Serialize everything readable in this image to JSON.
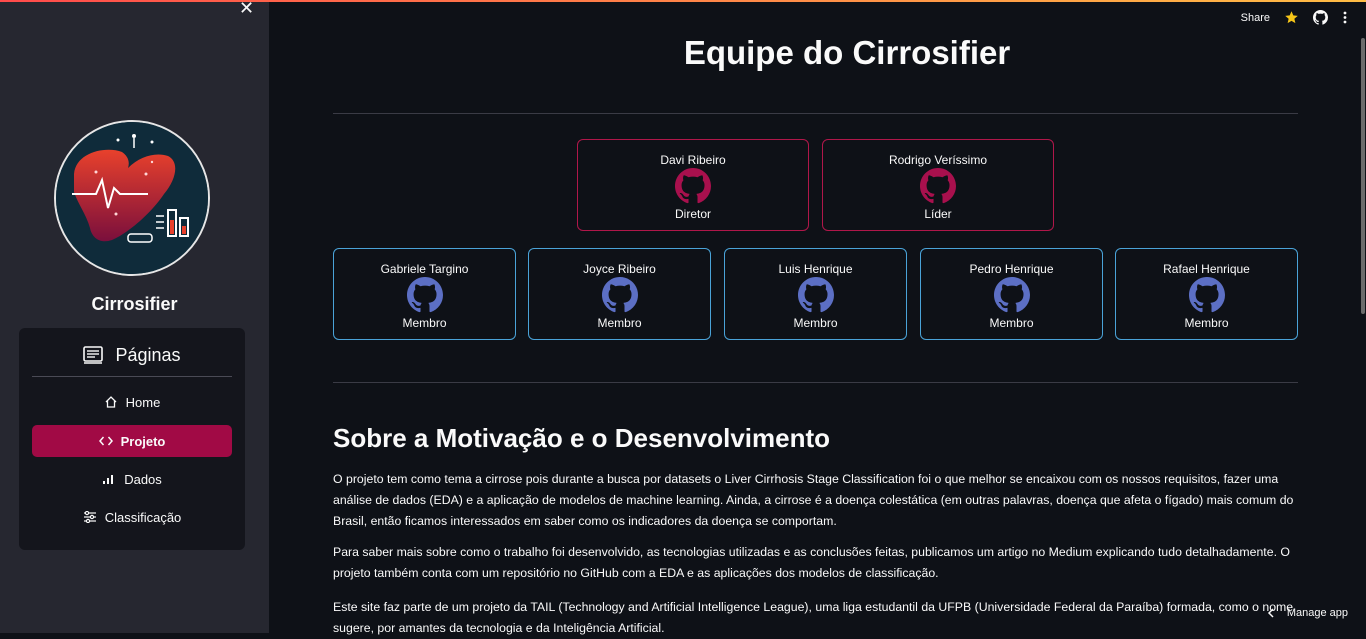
{
  "sidebar": {
    "app_title": "Cirrosifier",
    "nav_header": "Páginas",
    "items": [
      {
        "label": "Home"
      },
      {
        "label": "Projeto"
      },
      {
        "label": "Dados"
      },
      {
        "label": "Classificação"
      }
    ]
  },
  "toolbar": {
    "share_label": "Share"
  },
  "main": {
    "title": "Equipe do Cirrosifier",
    "leads": [
      {
        "name": "Davi Ribeiro",
        "role": "Diretor"
      },
      {
        "name": "Rodrigo Veríssimo",
        "role": "Líder"
      }
    ],
    "members": [
      {
        "name": "Gabriele Targino",
        "role": "Membro"
      },
      {
        "name": "Joyce Ribeiro",
        "role": "Membro"
      },
      {
        "name": "Luis Henrique",
        "role": "Membro"
      },
      {
        "name": "Pedro Henrique",
        "role": "Membro"
      },
      {
        "name": "Rafael Henrique",
        "role": "Membro"
      }
    ],
    "section_title": "Sobre a Motivação e o Desenvolvimento",
    "paragraphs": [
      "O projeto tem como tema a cirrose pois durante a busca por datasets o Liver Cirrhosis Stage Classification foi o que melhor se encaixou com os nossos requisitos, fazer uma análise de dados (EDA) e a aplicação de modelos de machine learning. Ainda, a cirrose é a doença colestática (em outras palavras, doença que afeta o fígado) mais comum do Brasil, então ficamos interessados em saber como os indicadores da doença se comportam.",
      "Para saber mais sobre como o trabalho foi desenvolvido, as tecnologias utilizadas e as conclusões feitas, publicamos um artigo no Medium explicando tudo detalhadamente. O projeto também conta com um repositório no GitHub com a EDA e as aplicações dos modelos de classificação.",
      "Este site faz parte de um projeto da TAIL (Technology and Artificial Intelligence League), uma liga estudantil da UFPB (Universidade Federal da Paraíba) formada, como o nome sugere, por amantes da tecnologia e da Inteligência Artificial."
    ],
    "manage_label": "Manage app"
  },
  "colors": {
    "accent": "#a10a45",
    "lead_border": "#b0174a",
    "member_border": "#4aa3d8",
    "lead_icon": "#a8104d",
    "member_icon": "#5c6fc4",
    "star": "#f5c518"
  },
  "icons": [
    "close-icon",
    "liver-logo",
    "pages-icon",
    "home-icon",
    "code-icon",
    "bar-chart-icon",
    "sliders-icon",
    "star-icon",
    "github-icon",
    "more-vertical-icon",
    "chevron-left-icon"
  ]
}
